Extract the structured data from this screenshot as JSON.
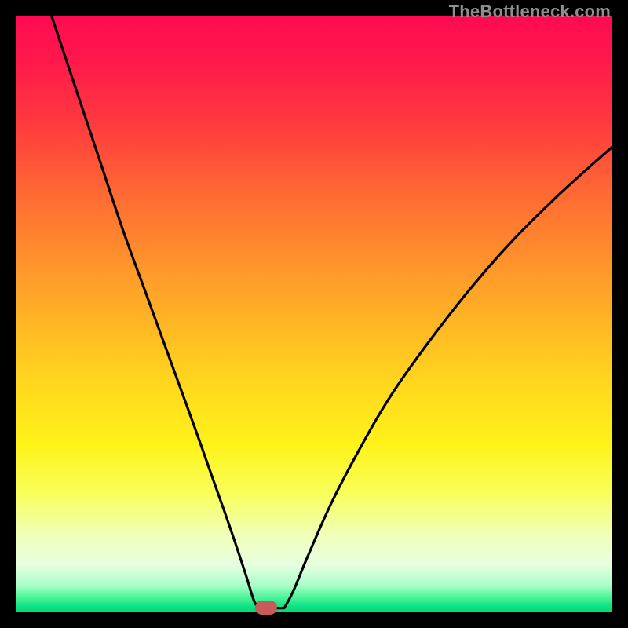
{
  "watermark": "TheBottleneck.com",
  "marker": {
    "x_pct": 42.0,
    "color": "#c85a5a",
    "w": 28,
    "h": 18
  },
  "gradient_stops": [
    {
      "offset": 0.0,
      "color": "#ff0a52"
    },
    {
      "offset": 0.08,
      "color": "#ff1a4b"
    },
    {
      "offset": 0.18,
      "color": "#ff3a3f"
    },
    {
      "offset": 0.3,
      "color": "#ff6a33"
    },
    {
      "offset": 0.45,
      "color": "#ffa029"
    },
    {
      "offset": 0.6,
      "color": "#ffd21f"
    },
    {
      "offset": 0.72,
      "color": "#fff31a"
    },
    {
      "offset": 0.8,
      "color": "#f8ff5a"
    },
    {
      "offset": 0.87,
      "color": "#f0ffb8"
    },
    {
      "offset": 0.92,
      "color": "#e8ffe0"
    },
    {
      "offset": 0.955,
      "color": "#a8ffc8"
    },
    {
      "offset": 0.975,
      "color": "#4cf598"
    },
    {
      "offset": 0.99,
      "color": "#0ee284"
    },
    {
      "offset": 1.0,
      "color": "#06d678"
    }
  ],
  "chart_data": {
    "type": "line",
    "title": "",
    "xlabel": "",
    "ylabel": "",
    "xlim": [
      0,
      100
    ],
    "ylim": [
      0,
      100
    ],
    "note": "x is horizontal position in percent; y is bottleneck severity in percent (0 = bottom/green, 100 = top/red). Minimum ≈ 42% on the x-axis.",
    "left_curve": [
      {
        "x": 6.0,
        "y": 100.0
      },
      {
        "x": 8.0,
        "y": 94.0
      },
      {
        "x": 11.0,
        "y": 85.0
      },
      {
        "x": 14.0,
        "y": 76.0
      },
      {
        "x": 18.0,
        "y": 64.0
      },
      {
        "x": 22.0,
        "y": 53.0
      },
      {
        "x": 26.0,
        "y": 42.0
      },
      {
        "x": 30.0,
        "y": 31.0
      },
      {
        "x": 33.0,
        "y": 22.5
      },
      {
        "x": 36.0,
        "y": 14.0
      },
      {
        "x": 38.5,
        "y": 6.5
      },
      {
        "x": 40.0,
        "y": 1.8
      },
      {
        "x": 41.0,
        "y": 0.7
      }
    ],
    "flat_segment": [
      {
        "x": 41.0,
        "y": 0.7
      },
      {
        "x": 45.0,
        "y": 0.7
      }
    ],
    "right_curve": [
      {
        "x": 45.0,
        "y": 0.7
      },
      {
        "x": 46.5,
        "y": 3.5
      },
      {
        "x": 49.0,
        "y": 9.5
      },
      {
        "x": 53.0,
        "y": 18.5
      },
      {
        "x": 58.0,
        "y": 28.0
      },
      {
        "x": 63.0,
        "y": 36.5
      },
      {
        "x": 69.0,
        "y": 45.0
      },
      {
        "x": 76.0,
        "y": 54.0
      },
      {
        "x": 83.0,
        "y": 62.0
      },
      {
        "x": 90.0,
        "y": 69.0
      },
      {
        "x": 96.0,
        "y": 74.5
      },
      {
        "x": 100.0,
        "y": 78.0
      }
    ]
  }
}
